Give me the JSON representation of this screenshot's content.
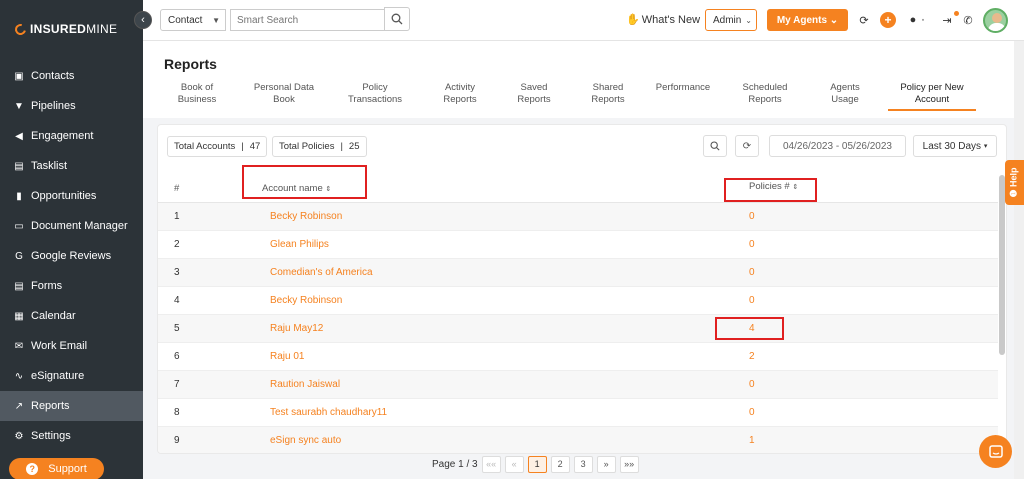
{
  "brand": {
    "name_bold": "INSURED",
    "name_light": "MINE"
  },
  "sidebar": {
    "items": [
      {
        "label": "Contacts",
        "icon": "contacts-icon",
        "glyph": "▣"
      },
      {
        "label": "Pipelines",
        "icon": "pipelines-icon",
        "glyph": "▼"
      },
      {
        "label": "Engagement",
        "icon": "megaphone-icon",
        "glyph": "◀"
      },
      {
        "label": "Tasklist",
        "icon": "tasklist-icon",
        "glyph": "▤"
      },
      {
        "label": "Opportunities",
        "icon": "bar-chart-icon",
        "glyph": "▮"
      },
      {
        "label": "Document Manager",
        "icon": "folder-icon",
        "glyph": "▭"
      },
      {
        "label": "Google Reviews",
        "icon": "google-icon",
        "glyph": "G"
      },
      {
        "label": "Forms",
        "icon": "forms-icon",
        "glyph": "▤"
      },
      {
        "label": "Calendar",
        "icon": "calendar-icon",
        "glyph": "▦"
      },
      {
        "label": "Work Email",
        "icon": "email-icon",
        "glyph": "✉"
      },
      {
        "label": "eSignature",
        "icon": "signature-icon",
        "glyph": "∿"
      },
      {
        "label": "Reports",
        "icon": "line-chart-icon",
        "glyph": "↗"
      },
      {
        "label": "Settings",
        "icon": "gear-icon",
        "glyph": "⚙"
      }
    ],
    "active_index": 11,
    "support_label": "Support"
  },
  "topbar": {
    "contact_select": "Contact",
    "search_placeholder": "Smart Search",
    "whats_new": "What's New",
    "admin_select": "Admin",
    "my_agents": "My Agents"
  },
  "reports": {
    "title": "Reports",
    "tabs": [
      {
        "label": "Book of\nBusiness"
      },
      {
        "label": "Personal Data\nBook"
      },
      {
        "label": "Policy\nTransactions"
      },
      {
        "label": "Activity\nReports"
      },
      {
        "label": "Saved\nReports"
      },
      {
        "label": "Shared\nReports"
      },
      {
        "label": "Performance"
      },
      {
        "label": "Scheduled\nReports"
      },
      {
        "label": "Agents\nUsage"
      },
      {
        "label": "Policy per New\nAccount"
      }
    ],
    "active_tab": 9
  },
  "stats": {
    "total_accounts_label": "Total Accounts",
    "total_accounts_value": "47",
    "total_policies_label": "Total Policies",
    "total_policies_value": "25"
  },
  "filters": {
    "date_range": "04/26/2023 - 05/26/2023",
    "period": "Last 30 Days"
  },
  "table": {
    "headers": {
      "num": "#",
      "account": "Account name",
      "policies": "Policies #"
    },
    "rows": [
      {
        "num": "1",
        "name": "Becky Robinson",
        "policies": "0"
      },
      {
        "num": "2",
        "name": "Glean Philips",
        "policies": "0"
      },
      {
        "num": "3",
        "name": "Comedian's of America",
        "policies": "0"
      },
      {
        "num": "4",
        "name": "Becky Robinson",
        "policies": "0"
      },
      {
        "num": "5",
        "name": "Raju May12",
        "policies": "4"
      },
      {
        "num": "6",
        "name": "Raju 01",
        "policies": "2"
      },
      {
        "num": "7",
        "name": "Raution Jaiswal",
        "policies": "0"
      },
      {
        "num": "8",
        "name": "Test saurabh chaudhary11",
        "policies": "0"
      },
      {
        "num": "9",
        "name": "eSign sync auto",
        "policies": "1"
      }
    ]
  },
  "pagination": {
    "page_label": "Page 1 / 3",
    "first": "««",
    "prev": "«",
    "pages": [
      "1",
      "2",
      "3"
    ],
    "next": "»",
    "last": "»»"
  },
  "help": {
    "label": "Help"
  },
  "colors": {
    "accent": "#f58220",
    "sidebar_bg": "#2c3338",
    "highlight": "#e02020"
  }
}
